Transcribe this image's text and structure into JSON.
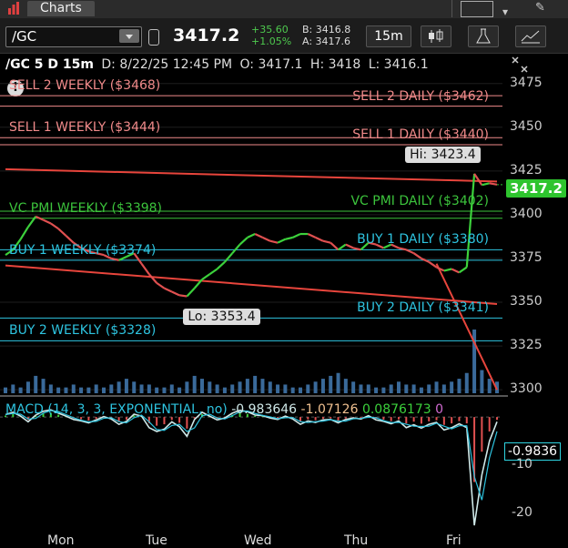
{
  "window": {
    "title": "Charts"
  },
  "toolbar": {
    "symbol": "/GC",
    "last": "3417.2",
    "change": "+35.60",
    "change_pct": "+1.05%",
    "bid": "B: 3416.8",
    "ask": "A: 3417.6",
    "timeframe": "15m"
  },
  "info": {
    "symbol_desc": "/GC 5 D 15m",
    "date": "D: 8/22/25 12:45 PM",
    "open": "O: 3417.1",
    "high": "H: 3418",
    "low": "L: 3416.1"
  },
  "levels": {
    "sell2_weekly": "SELL 2 WEEKLY ($3468)",
    "sell2_daily": "SELL 2 DAILY ($3462)",
    "sell1_weekly": "SELL 1 WEEKLY ($3444)",
    "sell1_daily": "SELL 1 DAILY ($3440)",
    "vc_weekly": "VC PMI WEEKLY ($3398)",
    "vc_daily": "VC PMI DAILY ($3402)",
    "buy1_weekly": "BUY 1 WEEKLY ($3374)",
    "buy1_daily": "BUY 1 DAILY ($3380)",
    "buy2_daily": "BUY 2 DAILY ($3341)",
    "buy2_weekly": "BUY 2 WEEKLY ($3328)"
  },
  "colors": {
    "sell": "#f08a8a",
    "vc": "#3cc43c",
    "buy": "#2ec4e0",
    "up": "#3cd13c",
    "down": "#e05050",
    "trend": "#e8453c",
    "macd": "#cfe8e8",
    "volume": "#3a6a9a"
  },
  "chart_data": {
    "type": "line",
    "title": "/GC 5 D 15m",
    "series": [
      {
        "values": [
          3377,
          3380,
          3386,
          3393,
          3399,
          3397,
          3395,
          3392,
          3388,
          3384,
          3381,
          3379,
          3378,
          3377,
          3375,
          3374,
          3376,
          3378,
          3372,
          3366,
          3361,
          3358,
          3356,
          3354,
          3353.4,
          3358,
          3363,
          3366,
          3369,
          3373,
          3378,
          3383,
          3387,
          3389,
          3387,
          3385,
          3384,
          3386,
          3387,
          3389,
          3389,
          3387,
          3385,
          3384,
          3380,
          3383,
          3381,
          3380,
          3384,
          3383,
          3381,
          3383,
          3381,
          3380,
          3378,
          3375,
          3373,
          3370,
          3368,
          3369,
          3367,
          3370,
          3423.4,
          3417,
          3418,
          3417.2
        ]
      }
    ],
    "x_labels": [
      "Mon",
      "Tue",
      "Wed",
      "Thu",
      "Fri"
    ],
    "y_ticks": [
      3300,
      3325,
      3350,
      3375,
      3400,
      3425,
      3450,
      3475
    ],
    "ylim": [
      3298,
      3479
    ],
    "last": 3417.2,
    "hi_label": "Hi: 3423.4",
    "lo_label": "Lo: 3353.4",
    "levels": [
      {
        "key": "sell2_weekly",
        "value": 3468,
        "color": "sell",
        "side": "left"
      },
      {
        "key": "sell2_daily",
        "value": 3462,
        "color": "sell",
        "side": "right"
      },
      {
        "key": "sell1_weekly",
        "value": 3444,
        "color": "sell",
        "side": "left"
      },
      {
        "key": "sell1_daily",
        "value": 3440,
        "color": "sell",
        "side": "right"
      },
      {
        "key": "vc_weekly",
        "value": 3398,
        "color": "vc",
        "side": "left"
      },
      {
        "key": "vc_daily",
        "value": 3402,
        "color": "vc",
        "side": "right"
      },
      {
        "key": "buy1_weekly",
        "value": 3374,
        "color": "buy",
        "side": "left"
      },
      {
        "key": "buy1_daily",
        "value": 3380,
        "color": "buy",
        "side": "right"
      },
      {
        "key": "buy2_daily",
        "value": 3341,
        "color": "buy",
        "side": "right"
      },
      {
        "key": "buy2_weekly",
        "value": 3328,
        "color": "buy",
        "side": "left"
      }
    ],
    "trendlines": [
      {
        "from": [
          0,
          3426
        ],
        "to": [
          65,
          3419
        ]
      },
      {
        "from": [
          0,
          3371
        ],
        "to": [
          65,
          3349
        ]
      },
      {
        "from": [
          57,
          3372
        ],
        "to": [
          65,
          3300
        ]
      }
    ],
    "volume": [
      2,
      3,
      2,
      4,
      6,
      5,
      3,
      2,
      2,
      3,
      2,
      2,
      3,
      2,
      3,
      4,
      5,
      4,
      3,
      3,
      2,
      2,
      3,
      2,
      4,
      6,
      5,
      4,
      3,
      2,
      3,
      4,
      5,
      6,
      5,
      4,
      3,
      3,
      2,
      2,
      3,
      4,
      5,
      6,
      7,
      5,
      4,
      3,
      3,
      2,
      2,
      3,
      4,
      3,
      3,
      2,
      3,
      4,
      3,
      4,
      5,
      7,
      22,
      8,
      5,
      4
    ]
  },
  "macd": {
    "legend": "MACD (14, 3, 3, EXPONENTIAL, no)",
    "value": "-0.983646",
    "avg": "-1.07126",
    "diff": "0.0876173",
    "last_label": "-0.9836",
    "y_ticks": [
      "-10",
      "-20"
    ],
    "ylim": [
      -24,
      4
    ],
    "values": [
      0.5,
      1,
      0.2,
      -1,
      0.4,
      1.2,
      1.5,
      0.8,
      0.2,
      -0.5,
      -0.8,
      -1.2,
      -0.6,
      0.1,
      -0.4,
      -1.5,
      -0.9,
      0.6,
      0.2,
      -2.2,
      -3,
      -2.5,
      -1,
      -2,
      -4,
      -0.5,
      1,
      0.2,
      -0.6,
      -0.2,
      0.8,
      1.4,
      1.1,
      0.4,
      0.3,
      -0.2,
      -0.5,
      0.2,
      -0.4,
      -1.5,
      -0.8,
      -1.1,
      -0.6,
      -0.5,
      -1.2,
      -0.5,
      -0.2,
      -0.4,
      0.3,
      -0.6,
      -0.9,
      -1.4,
      -0.8,
      -2.2,
      -1.6,
      -2.3,
      -1.5,
      -1.1,
      -2.7,
      -2.2,
      -1.4,
      -2.2,
      -22.5,
      -12,
      -5,
      -0.98
    ]
  }
}
